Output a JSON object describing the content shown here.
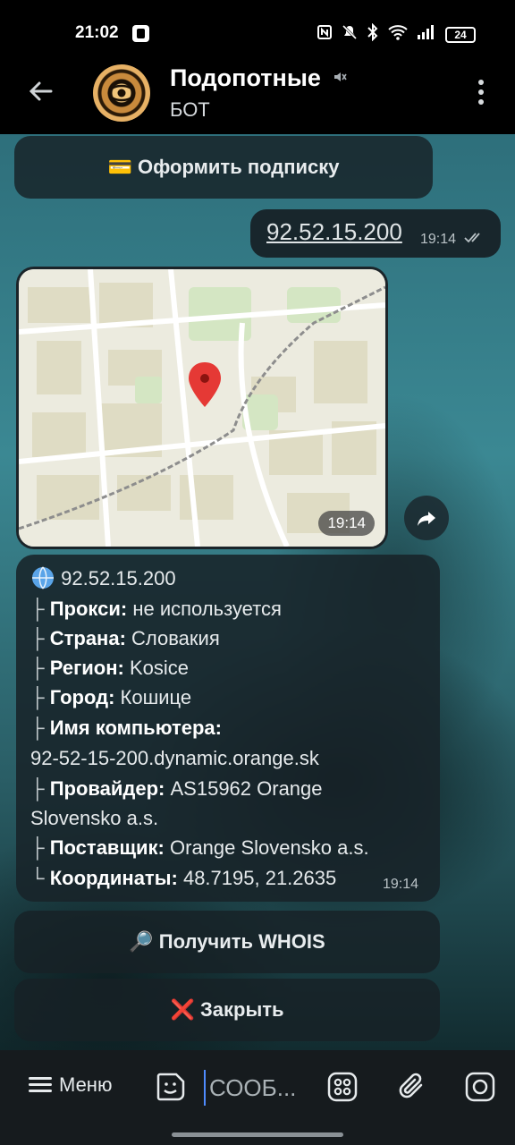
{
  "status_bar": {
    "time": "21:02",
    "battery": "24",
    "icons": [
      "nfc-icon",
      "mute-icon",
      "bluetooth-icon",
      "wifi-icon",
      "signal-icon",
      "battery-icon"
    ]
  },
  "header": {
    "title": "Подопотные",
    "subtitle": "БОТ",
    "muted": true
  },
  "messages": {
    "subscribe_button": "💳 Оформить подписку",
    "outgoing": {
      "text": "92.52.15.200",
      "time": "19:14"
    },
    "map": {
      "time": "19:14"
    },
    "info": {
      "ip_line": "92.52.15.200",
      "rows": [
        {
          "prefix": "├",
          "label": "Прокси:",
          "value": "не используется"
        },
        {
          "prefix": "├",
          "label": "Страна:",
          "value": "Словакия"
        },
        {
          "prefix": "├",
          "label": "Регион:",
          "value": "Kosice"
        },
        {
          "prefix": "├",
          "label": "Город:",
          "value": "Кошице"
        },
        {
          "prefix": "├",
          "label": "Имя компьютера:",
          "value": "",
          "continuation": "92-52-15-200.dynamic.orange.sk"
        },
        {
          "prefix": "├",
          "label": "Провайдер:",
          "value": "AS15962 Orange",
          "continuation": "Slovensko a.s."
        },
        {
          "prefix": "├",
          "label": "Поставщик:",
          "value": "Orange Slovensko a.s."
        },
        {
          "prefix": "└",
          "label": "Координаты:",
          "value": "48.7195, 21.2635"
        }
      ],
      "time": "19:14"
    }
  },
  "keyboard": {
    "whois": "🔎 Получить WHOIS",
    "close": "❌ Закрыть"
  },
  "composer": {
    "menu_label": "Меню",
    "placeholder": "СООБ..."
  },
  "colors": {
    "bubble": "#18262c",
    "accent_cursor": "#4f8cff",
    "map_pin": "#e53935"
  }
}
